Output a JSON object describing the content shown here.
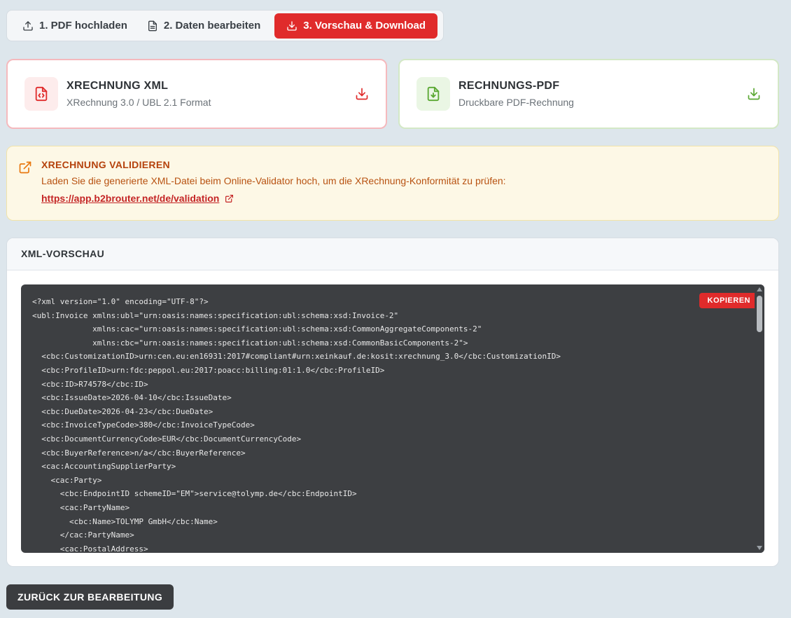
{
  "steps": [
    {
      "label": "1. PDF hochladen",
      "icon": "upload-icon"
    },
    {
      "label": "2. Daten bearbeiten",
      "icon": "document-icon"
    },
    {
      "label": "3. Vorschau & Download",
      "icon": "download-icon"
    }
  ],
  "active_step": 3,
  "downloads": {
    "xml": {
      "title": "XRECHNUNG XML",
      "subtitle": "XRechnung 3.0 / UBL 2.1 Format",
      "icon": "code-file-icon",
      "color": "#e02b2b"
    },
    "pdf": {
      "title": "RECHNUNGS-PDF",
      "subtitle": "Druckbare PDF-Rechnung",
      "icon": "pdf-download-icon",
      "color": "#5aa832"
    }
  },
  "notice": {
    "title": "XRECHNUNG VALIDIEREN",
    "text": "Laden Sie die generierte XML-Datei beim Online-Validator hoch, um die XRechnung-Konformität zu prüfen:",
    "link": "https://app.b2brouter.net/de/validation",
    "color": "#b5420c"
  },
  "preview": {
    "title": "XML-VORSCHAU",
    "copy_label": "KOPIEREN",
    "lines": [
      "<?xml version=\"1.0\" encoding=\"UTF-8\"?>",
      "<ubl:Invoice xmlns:ubl=\"urn:oasis:names:specification:ubl:schema:xsd:Invoice-2\"",
      "             xmlns:cac=\"urn:oasis:names:specification:ubl:schema:xsd:CommonAggregateComponents-2\"",
      "             xmlns:cbc=\"urn:oasis:names:specification:ubl:schema:xsd:CommonBasicComponents-2\">",
      "  <cbc:CustomizationID>urn:cen.eu:en16931:2017#compliant#urn:xeinkauf.de:kosit:xrechnung_3.0</cbc:CustomizationID>",
      "  <cbc:ProfileID>urn:fdc:peppol.eu:2017:poacc:billing:01:1.0</cbc:ProfileID>",
      "  <cbc:ID>R74578</cbc:ID>",
      "  <cbc:IssueDate>2026-04-10</cbc:IssueDate>",
      "  <cbc:DueDate>2026-04-23</cbc:DueDate>",
      "  <cbc:InvoiceTypeCode>380</cbc:InvoiceTypeCode>",
      "  <cbc:DocumentCurrencyCode>EUR</cbc:DocumentCurrencyCode>",
      "  <cbc:BuyerReference>n/a</cbc:BuyerReference>",
      "  <cac:AccountingSupplierParty>",
      "    <cac:Party>",
      "      <cbc:EndpointID schemeID=\"EM\">service@tolymp.de</cbc:EndpointID>",
      "      <cac:PartyName>",
      "        <cbc:Name>TOLYMP GmbH</cbc:Name>",
      "      </cac:PartyName>",
      "      <cac:PostalAddress>"
    ]
  },
  "back_label": "ZURÜCK ZUR BEARBEITUNG"
}
